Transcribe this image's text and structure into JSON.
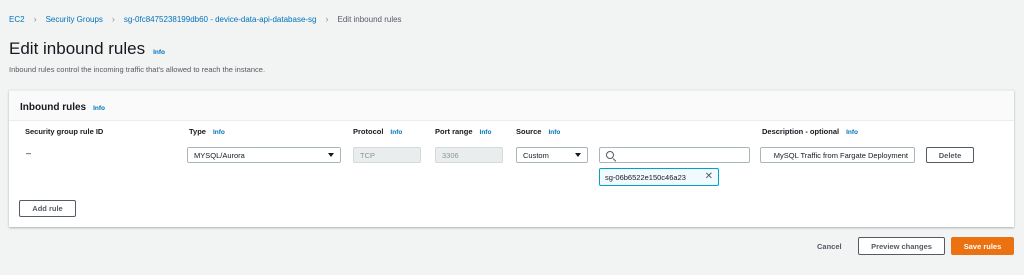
{
  "breadcrumb": {
    "items": [
      "EC2",
      "Security Groups",
      "sg-0fc8475238199db60 - device-data-api-database-sg"
    ],
    "current": "Edit inbound rules"
  },
  "page": {
    "title": "Edit inbound rules",
    "info": "Info",
    "description": "Inbound rules control the incoming traffic that's allowed to reach the instance."
  },
  "panel": {
    "title": "Inbound rules",
    "info": "Info",
    "columns": {
      "rule_id": "Security group rule ID",
      "type": "Type",
      "protocol": "Protocol",
      "port_range": "Port range",
      "source": "Source",
      "description": "Description - optional",
      "info": "Info"
    },
    "row": {
      "rule_id": "–",
      "type": "MYSQL/Aurora",
      "protocol": "TCP",
      "port_range": "3306",
      "source": "Custom",
      "search_value": "",
      "token": "sg-06b6522e150c46a23",
      "description": "MySQL Traffic from Fargate Deployment",
      "delete_label": "Delete"
    },
    "add_rule_label": "Add rule"
  },
  "footer": {
    "cancel_label": "Cancel",
    "preview_label": "Preview changes",
    "save_label": "Save rules"
  },
  "colors": {
    "link": "#0073bb",
    "primary": "#ec7211",
    "token_border": "#00a1c9"
  }
}
